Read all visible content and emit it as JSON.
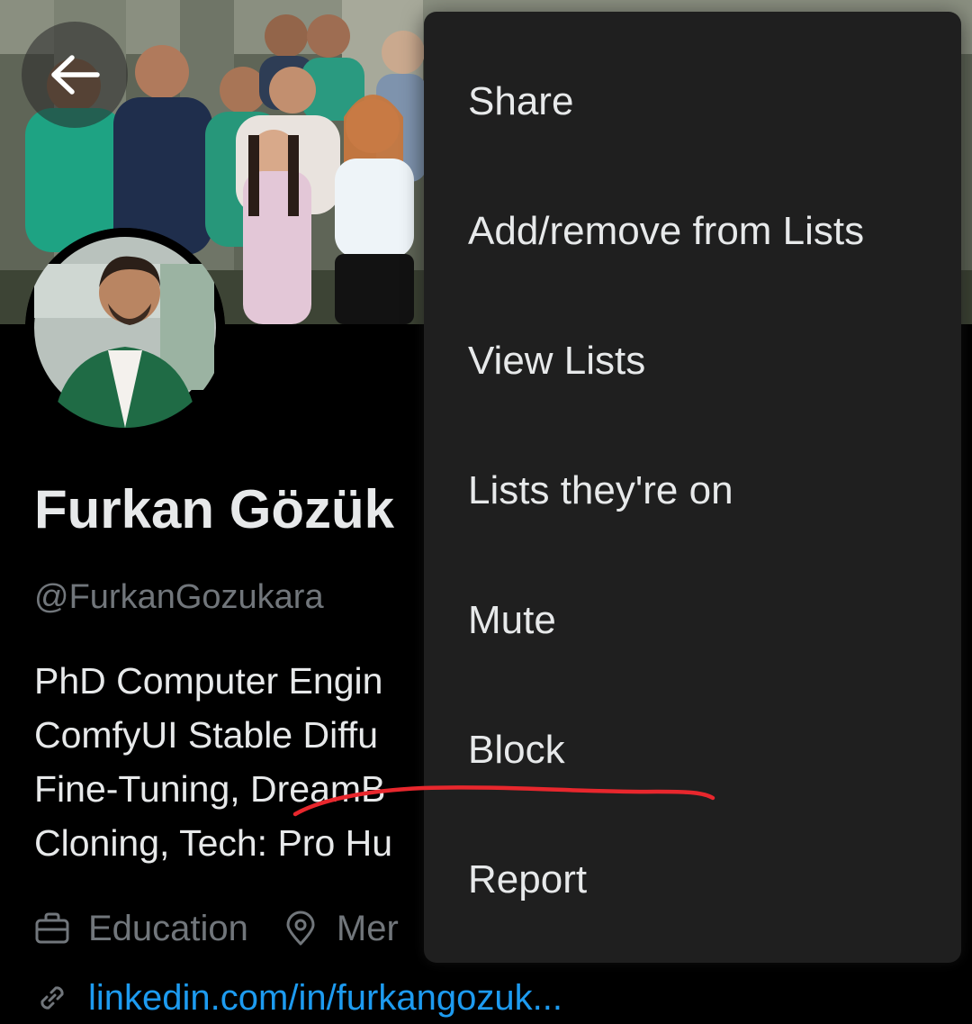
{
  "profile": {
    "display_name": "Furkan Gözük",
    "handle": "@FurkanGozukara",
    "bio_lines": [
      "PhD Computer Engin",
      "ComfyUI Stable Diffu",
      "Fine-Tuning, DreamB",
      "Cloning, Tech: Pro Hu"
    ],
    "category": "Education",
    "location": "Mer",
    "link": "linkedin.com/in/furkangozuk..."
  },
  "menu": {
    "items": [
      {
        "label": "Share"
      },
      {
        "label": "Add/remove from Lists"
      },
      {
        "label": "View Lists"
      },
      {
        "label": "Lists they're on"
      },
      {
        "label": "Mute"
      },
      {
        "label": "Block"
      },
      {
        "label": "Report"
      }
    ]
  },
  "icons": {
    "back": "arrow-left-icon",
    "category": "briefcase-icon",
    "location": "location-pin-icon",
    "link": "link-icon"
  },
  "colors": {
    "background": "#000000",
    "menu_background": "#1f1f1f",
    "primary_text": "#e7e9ea",
    "secondary_text": "#71767b",
    "link": "#1d9bf0",
    "annotation": "#e8272d"
  }
}
